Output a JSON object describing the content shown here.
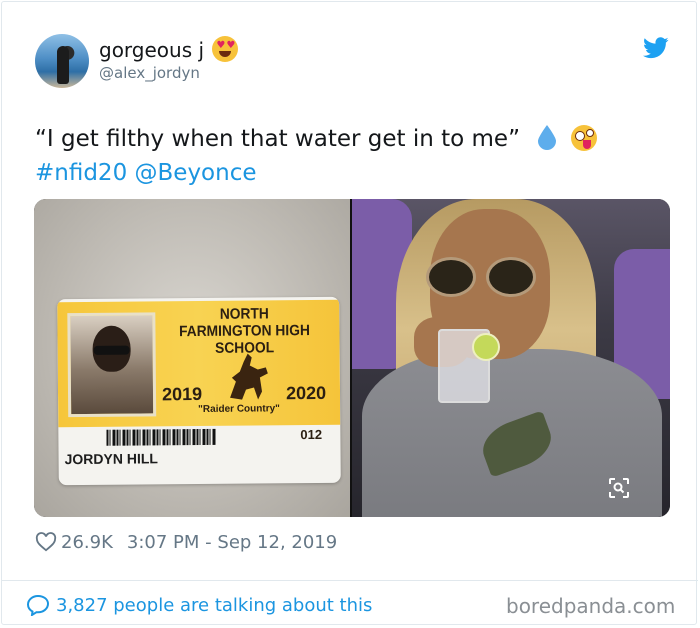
{
  "tweet": {
    "display_name": "gorgeous j",
    "display_name_emoji": "heart-eyes-emoji",
    "handle": "@alex_jordyn",
    "text_quote": "“I get filthy when that water get in to me”",
    "text_emojis": [
      "droplet-emoji",
      "zany-face-emoji"
    ],
    "hashtag": "#nfid20",
    "mention": "@Beyonce",
    "likes": "26.9K",
    "time": "3:07 PM",
    "date_separator": "-",
    "date": "Sep 12, 2019",
    "talking": "3,827 people are talking about this"
  },
  "id_card": {
    "school": "NORTH FARMINGTON HIGH SCHOOL",
    "year_start": "2019",
    "year_end": "2020",
    "motto": "\"Raider  Country\"",
    "id_number": "012",
    "student_name": "JORDYN HILL"
  },
  "watermark": "boredpanda.com",
  "colors": {
    "twitter_blue": "#1b95e0",
    "text_primary": "#14171a",
    "text_secondary": "#657786",
    "card_yellow": "#f6c63a"
  },
  "icons": [
    "twitter-bird-icon",
    "heart-icon",
    "speech-bubble-icon",
    "visual-search-icon"
  ]
}
